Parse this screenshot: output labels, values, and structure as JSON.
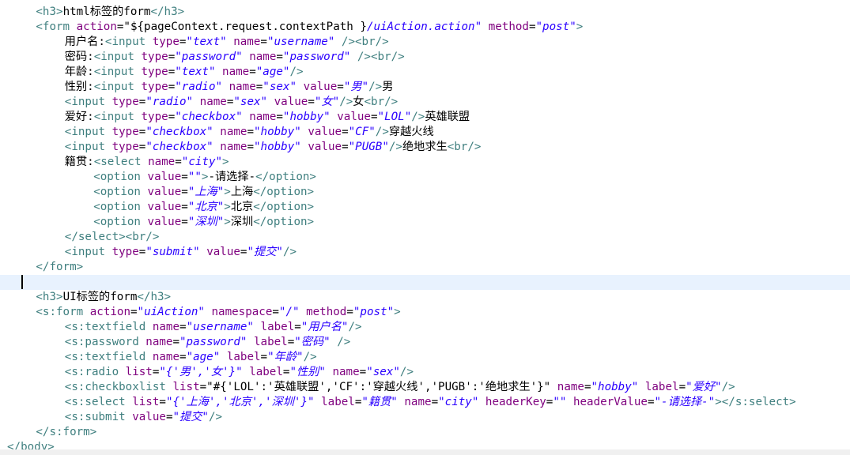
{
  "colors": {
    "tag": "#3f7f7f",
    "attribute": "#7f007f",
    "value": "#2a00ff",
    "text": "#000000",
    "current_line": "#e8f2fe"
  },
  "lines": [
    {
      "indent": 2,
      "current": false,
      "tokens": [
        [
          "tag",
          "<h3>"
        ],
        [
          "txt",
          "html标签的form"
        ],
        [
          "tag",
          "</h3>"
        ]
      ]
    },
    {
      "indent": 2,
      "current": false,
      "tokens": [
        [
          "tag",
          "<form "
        ],
        [
          "attr",
          "action"
        ],
        [
          "txt",
          "=\"${pageContext.request.contextPath }"
        ],
        [
          "val",
          "/uiAction.action\""
        ],
        [
          "txt",
          " "
        ],
        [
          "attr",
          "method"
        ],
        [
          "txt",
          "="
        ],
        [
          "val",
          "\"post\""
        ],
        [
          "tag",
          ">"
        ]
      ]
    },
    {
      "indent": 4,
      "current": false,
      "tokens": [
        [
          "txt",
          "用户名:"
        ],
        [
          "tag",
          "<input "
        ],
        [
          "attr",
          "type"
        ],
        [
          "txt",
          "="
        ],
        [
          "val",
          "\"text\""
        ],
        [
          "txt",
          " "
        ],
        [
          "attr",
          "name"
        ],
        [
          "txt",
          "="
        ],
        [
          "val",
          "\"username\""
        ],
        [
          "txt",
          " "
        ],
        [
          "tag",
          "/><br/>"
        ]
      ]
    },
    {
      "indent": 4,
      "current": false,
      "tokens": [
        [
          "txt",
          "密码:"
        ],
        [
          "tag",
          "<input "
        ],
        [
          "attr",
          "type"
        ],
        [
          "txt",
          "="
        ],
        [
          "val",
          "\"password\""
        ],
        [
          "txt",
          " "
        ],
        [
          "attr",
          "name"
        ],
        [
          "txt",
          "="
        ],
        [
          "val",
          "\"password\""
        ],
        [
          "txt",
          " "
        ],
        [
          "tag",
          "/><br/>"
        ]
      ]
    },
    {
      "indent": 4,
      "current": false,
      "tokens": [
        [
          "txt",
          "年龄:"
        ],
        [
          "tag",
          "<input "
        ],
        [
          "attr",
          "type"
        ],
        [
          "txt",
          "="
        ],
        [
          "val",
          "\"text\""
        ],
        [
          "txt",
          " "
        ],
        [
          "attr",
          "name"
        ],
        [
          "txt",
          "="
        ],
        [
          "val",
          "\"age\""
        ],
        [
          "tag",
          "/>"
        ]
      ]
    },
    {
      "indent": 4,
      "current": false,
      "tokens": [
        [
          "txt",
          "性别:"
        ],
        [
          "tag",
          "<input "
        ],
        [
          "attr",
          "type"
        ],
        [
          "txt",
          "="
        ],
        [
          "val",
          "\"radio\""
        ],
        [
          "txt",
          " "
        ],
        [
          "attr",
          "name"
        ],
        [
          "txt",
          "="
        ],
        [
          "val",
          "\"sex\""
        ],
        [
          "txt",
          " "
        ],
        [
          "attr",
          "value"
        ],
        [
          "txt",
          "="
        ],
        [
          "val",
          "\"男\""
        ],
        [
          "tag",
          "/>"
        ],
        [
          "txt",
          "男"
        ]
      ]
    },
    {
      "indent": 4,
      "current": false,
      "tokens": [
        [
          "tag",
          "<input "
        ],
        [
          "attr",
          "type"
        ],
        [
          "txt",
          "="
        ],
        [
          "val",
          "\"radio\""
        ],
        [
          "txt",
          " "
        ],
        [
          "attr",
          "name"
        ],
        [
          "txt",
          "="
        ],
        [
          "val",
          "\"sex\""
        ],
        [
          "txt",
          " "
        ],
        [
          "attr",
          "value"
        ],
        [
          "txt",
          "="
        ],
        [
          "val",
          "\"女\""
        ],
        [
          "tag",
          "/>"
        ],
        [
          "txt",
          "女"
        ],
        [
          "tag",
          "<br/>"
        ]
      ]
    },
    {
      "indent": 4,
      "current": false,
      "tokens": [
        [
          "txt",
          "爱好:"
        ],
        [
          "tag",
          "<input "
        ],
        [
          "attr",
          "type"
        ],
        [
          "txt",
          "="
        ],
        [
          "val",
          "\"checkbox\""
        ],
        [
          "txt",
          " "
        ],
        [
          "attr",
          "name"
        ],
        [
          "txt",
          "="
        ],
        [
          "val",
          "\"hobby\""
        ],
        [
          "txt",
          " "
        ],
        [
          "attr",
          "value"
        ],
        [
          "txt",
          "="
        ],
        [
          "val",
          "\"LOL\""
        ],
        [
          "tag",
          "/>"
        ],
        [
          "txt",
          "英雄联盟"
        ]
      ]
    },
    {
      "indent": 4,
      "current": false,
      "tokens": [
        [
          "tag",
          "<input "
        ],
        [
          "attr",
          "type"
        ],
        [
          "txt",
          "="
        ],
        [
          "val",
          "\"checkbox\""
        ],
        [
          "txt",
          " "
        ],
        [
          "attr",
          "name"
        ],
        [
          "txt",
          "="
        ],
        [
          "val",
          "\"hobby\""
        ],
        [
          "txt",
          " "
        ],
        [
          "attr",
          "value"
        ],
        [
          "txt",
          "="
        ],
        [
          "val",
          "\"CF\""
        ],
        [
          "tag",
          "/>"
        ],
        [
          "txt",
          "穿越火线"
        ]
      ]
    },
    {
      "indent": 4,
      "current": false,
      "tokens": [
        [
          "tag",
          "<input "
        ],
        [
          "attr",
          "type"
        ],
        [
          "txt",
          "="
        ],
        [
          "val",
          "\"checkbox\""
        ],
        [
          "txt",
          " "
        ],
        [
          "attr",
          "name"
        ],
        [
          "txt",
          "="
        ],
        [
          "val",
          "\"hobby\""
        ],
        [
          "txt",
          " "
        ],
        [
          "attr",
          "value"
        ],
        [
          "txt",
          "="
        ],
        [
          "val",
          "\"PUGB\""
        ],
        [
          "tag",
          "/>"
        ],
        [
          "txt",
          "绝地求生"
        ],
        [
          "tag",
          "<br/>"
        ]
      ]
    },
    {
      "indent": 4,
      "current": false,
      "tokens": [
        [
          "txt",
          "籍贯:"
        ],
        [
          "tag",
          "<select "
        ],
        [
          "attr",
          "name"
        ],
        [
          "txt",
          "="
        ],
        [
          "val",
          "\"city\""
        ],
        [
          "tag",
          ">"
        ]
      ]
    },
    {
      "indent": 6,
      "current": false,
      "tokens": [
        [
          "tag",
          "<option "
        ],
        [
          "attr",
          "value"
        ],
        [
          "txt",
          "="
        ],
        [
          "val",
          "\"\""
        ],
        [
          "tag",
          ">"
        ],
        [
          "txt",
          "-请选择-"
        ],
        [
          "tag",
          "</option>"
        ]
      ]
    },
    {
      "indent": 6,
      "current": false,
      "tokens": [
        [
          "tag",
          "<option "
        ],
        [
          "attr",
          "value"
        ],
        [
          "txt",
          "="
        ],
        [
          "val",
          "\"上海\""
        ],
        [
          "tag",
          ">"
        ],
        [
          "txt",
          "上海"
        ],
        [
          "tag",
          "</option>"
        ]
      ]
    },
    {
      "indent": 6,
      "current": false,
      "tokens": [
        [
          "tag",
          "<option "
        ],
        [
          "attr",
          "value"
        ],
        [
          "txt",
          "="
        ],
        [
          "val",
          "\"北京\""
        ],
        [
          "tag",
          ">"
        ],
        [
          "txt",
          "北京"
        ],
        [
          "tag",
          "</option>"
        ]
      ]
    },
    {
      "indent": 6,
      "current": false,
      "tokens": [
        [
          "tag",
          "<option "
        ],
        [
          "attr",
          "value"
        ],
        [
          "txt",
          "="
        ],
        [
          "val",
          "\"深圳\""
        ],
        [
          "tag",
          ">"
        ],
        [
          "txt",
          "深圳"
        ],
        [
          "tag",
          "</option>"
        ]
      ]
    },
    {
      "indent": 4,
      "current": false,
      "tokens": [
        [
          "tag",
          "</select><br/>"
        ]
      ]
    },
    {
      "indent": 4,
      "current": false,
      "tokens": [
        [
          "tag",
          "<input "
        ],
        [
          "attr",
          "type"
        ],
        [
          "txt",
          "="
        ],
        [
          "val",
          "\"submit\""
        ],
        [
          "txt",
          " "
        ],
        [
          "attr",
          "value"
        ],
        [
          "txt",
          "="
        ],
        [
          "val",
          "\"提交\""
        ],
        [
          "tag",
          "/>"
        ]
      ]
    },
    {
      "indent": 2,
      "current": false,
      "tokens": [
        [
          "tag",
          "</form>"
        ]
      ]
    },
    {
      "indent": 2,
      "current": true,
      "tokens": []
    },
    {
      "indent": 2,
      "current": false,
      "tokens": [
        [
          "tag",
          "<h3>"
        ],
        [
          "txt",
          "UI标签的form"
        ],
        [
          "tag",
          "</h3>"
        ]
      ]
    },
    {
      "indent": 2,
      "current": false,
      "tokens": [
        [
          "tag",
          "<s:form "
        ],
        [
          "attr",
          "action"
        ],
        [
          "txt",
          "="
        ],
        [
          "val",
          "\"uiAction\""
        ],
        [
          "txt",
          " "
        ],
        [
          "attr",
          "namespace"
        ],
        [
          "txt",
          "="
        ],
        [
          "val",
          "\"/\""
        ],
        [
          "txt",
          " "
        ],
        [
          "attr",
          "method"
        ],
        [
          "txt",
          "="
        ],
        [
          "val",
          "\"post\""
        ],
        [
          "tag",
          ">"
        ]
      ]
    },
    {
      "indent": 4,
      "current": false,
      "tokens": [
        [
          "tag",
          "<s:textfield "
        ],
        [
          "attr",
          "name"
        ],
        [
          "txt",
          "="
        ],
        [
          "val",
          "\"username\""
        ],
        [
          "txt",
          " "
        ],
        [
          "attr",
          "label"
        ],
        [
          "txt",
          "="
        ],
        [
          "val",
          "\"用户名\""
        ],
        [
          "tag",
          "/>"
        ]
      ]
    },
    {
      "indent": 4,
      "current": false,
      "tokens": [
        [
          "tag",
          "<s:password "
        ],
        [
          "attr",
          "name"
        ],
        [
          "txt",
          "="
        ],
        [
          "val",
          "\"password\""
        ],
        [
          "txt",
          " "
        ],
        [
          "attr",
          "label"
        ],
        [
          "txt",
          "="
        ],
        [
          "val",
          "\"密码\""
        ],
        [
          "txt",
          " "
        ],
        [
          "tag",
          "/>"
        ]
      ]
    },
    {
      "indent": 4,
      "current": false,
      "tokens": [
        [
          "tag",
          "<s:textfield "
        ],
        [
          "attr",
          "name"
        ],
        [
          "txt",
          "="
        ],
        [
          "val",
          "\"age\""
        ],
        [
          "txt",
          " "
        ],
        [
          "attr",
          "label"
        ],
        [
          "txt",
          "="
        ],
        [
          "val",
          "\"年龄\""
        ],
        [
          "tag",
          "/>"
        ]
      ]
    },
    {
      "indent": 4,
      "current": false,
      "tokens": [
        [
          "tag",
          "<s:radio "
        ],
        [
          "attr",
          "list"
        ],
        [
          "txt",
          "="
        ],
        [
          "val",
          "\"{'男','女'}\""
        ],
        [
          "txt",
          " "
        ],
        [
          "attr",
          "label"
        ],
        [
          "txt",
          "="
        ],
        [
          "val",
          "\"性别\""
        ],
        [
          "txt",
          " "
        ],
        [
          "attr",
          "name"
        ],
        [
          "txt",
          "="
        ],
        [
          "val",
          "\"sex\""
        ],
        [
          "tag",
          "/>"
        ]
      ]
    },
    {
      "indent": 4,
      "current": false,
      "tokens": [
        [
          "tag",
          "<s:checkboxlist "
        ],
        [
          "attr",
          "list"
        ],
        [
          "txt",
          "=\"#{'LOL':'英雄联盟','CF':'穿越火线','PUGB':'绝地求生'}\""
        ],
        [
          "txt",
          " "
        ],
        [
          "attr",
          "name"
        ],
        [
          "txt",
          "="
        ],
        [
          "val",
          "\"hobby\""
        ],
        [
          "txt",
          " "
        ],
        [
          "attr",
          "label"
        ],
        [
          "txt",
          "="
        ],
        [
          "val",
          "\"爱好\""
        ],
        [
          "tag",
          "/>"
        ]
      ]
    },
    {
      "indent": 4,
      "current": false,
      "tokens": [
        [
          "tag",
          "<s:select "
        ],
        [
          "attr",
          "list"
        ],
        [
          "txt",
          "="
        ],
        [
          "val",
          "\"{'上海','北京','深圳'}\""
        ],
        [
          "txt",
          " "
        ],
        [
          "attr",
          "label"
        ],
        [
          "txt",
          "="
        ],
        [
          "val",
          "\"籍贯\""
        ],
        [
          "txt",
          " "
        ],
        [
          "attr",
          "name"
        ],
        [
          "txt",
          "="
        ],
        [
          "val",
          "\"city\""
        ],
        [
          "txt",
          " "
        ],
        [
          "attr",
          "headerKey"
        ],
        [
          "txt",
          "="
        ],
        [
          "val",
          "\"\""
        ],
        [
          "txt",
          " "
        ],
        [
          "attr",
          "headerValue"
        ],
        [
          "txt",
          "="
        ],
        [
          "val",
          "\"-请选择-\""
        ],
        [
          "tag",
          "></s:select>"
        ]
      ]
    },
    {
      "indent": 4,
      "current": false,
      "tokens": [
        [
          "tag",
          "<s:submit "
        ],
        [
          "attr",
          "value"
        ],
        [
          "txt",
          "="
        ],
        [
          "val",
          "\"提交\""
        ],
        [
          "tag",
          "/>"
        ]
      ]
    },
    {
      "indent": 2,
      "current": false,
      "tokens": [
        [
          "tag",
          "</s:form>"
        ]
      ]
    },
    {
      "indent": 0,
      "current": false,
      "tokens": [
        [
          "tag",
          "</body>"
        ]
      ]
    }
  ]
}
